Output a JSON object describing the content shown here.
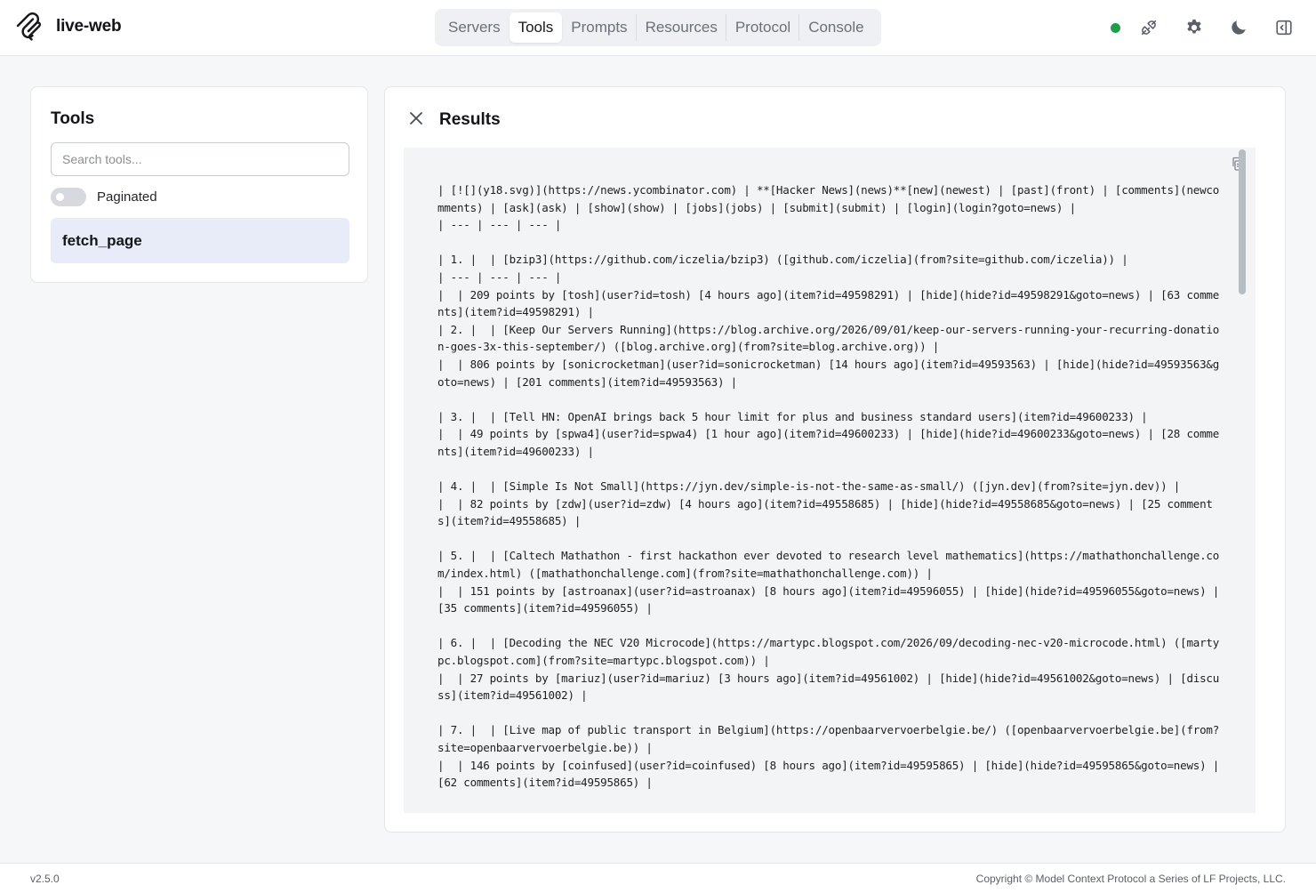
{
  "app": {
    "name": "live-web",
    "logo_icon": "mcp-logo-icon"
  },
  "nav": {
    "tabs": [
      {
        "label": "Servers",
        "active": false
      },
      {
        "label": "Tools",
        "active": true
      },
      {
        "label": "Prompts",
        "active": false
      },
      {
        "label": "Resources",
        "active": false
      },
      {
        "label": "Protocol",
        "active": false
      },
      {
        "label": "Console",
        "active": false
      }
    ]
  },
  "header": {
    "status_color": "#1f9d4c",
    "icons": [
      "connection-icon",
      "gear-icon",
      "moon-icon",
      "sidebar-toggle-icon"
    ]
  },
  "tools_panel": {
    "title": "Tools",
    "search_placeholder": "Search tools...",
    "search_value": "",
    "paginated_label": "Paginated",
    "paginated_on": false,
    "items": [
      {
        "label": "fetch_page",
        "selected": true
      }
    ]
  },
  "results_panel": {
    "title": "Results",
    "content": "| [![](y18.svg)](https://news.ycombinator.com) | **[Hacker News](news)**[new](newest) | [past](front) | [comments](newcomments) | [ask](ask) | [show](show) | [jobs](jobs) | [submit](submit) | [login](login?goto=news) |\n| --- | --- | --- |\n\n| 1. |  | [bzip3](https://github.com/iczelia/bzip3) ([github.com/iczelia](from?site=github.com/iczelia)) |\n| --- | --- | --- |\n|  | 209 points by [tosh](user?id=tosh) [4 hours ago](item?id=49598291) | [hide](hide?id=49598291&goto=news) | [63 comments](item?id=49598291) |\n| 2. |  | [Keep Our Servers Running](https://blog.archive.org/2026/09/01/keep-our-servers-running-your-recurring-donation-goes-3x-this-september/) ([blog.archive.org](from?site=blog.archive.org)) |\n|  | 806 points by [sonicrocketman](user?id=sonicrocketman) [14 hours ago](item?id=49593563) | [hide](hide?id=49593563&goto=news) | [201 comments](item?id=49593563) |\n\n| 3. |  | [Tell HN: OpenAI brings back 5 hour limit for plus and business standard users](item?id=49600233) |\n|  | 49 points by [spwa4](user?id=spwa4) [1 hour ago](item?id=49600233) | [hide](hide?id=49600233&goto=news) | [28 comments](item?id=49600233) |\n\n| 4. |  | [Simple Is Not Small](https://jyn.dev/simple-is-not-the-same-as-small/) ([jyn.dev](from?site=jyn.dev)) |\n|  | 82 points by [zdw](user?id=zdw) [4 hours ago](item?id=49558685) | [hide](hide?id=49558685&goto=news) | [25 comments](item?id=49558685) |\n\n| 5. |  | [Caltech Mathathon - first hackathon ever devoted to research level mathematics](https://mathathonchallenge.com/index.html) ([mathathonchallenge.com](from?site=mathathonchallenge.com)) |\n|  | 151 points by [astroanax](user?id=astroanax) [8 hours ago](item?id=49596055) | [hide](hide?id=49596055&goto=news) | [35 comments](item?id=49596055) |\n\n| 6. |  | [Decoding the NEC V20 Microcode](https://martypc.blogspot.com/2026/09/decoding-nec-v20-microcode.html) ([martypc.blogspot.com](from?site=martypc.blogspot.com)) |\n|  | 27 points by [mariuz](user?id=mariuz) [3 hours ago](item?id=49561002) | [hide](hide?id=49561002&goto=news) | [discuss](item?id=49561002) |\n\n| 7. |  | [Live map of public transport in Belgium](https://openbaarvervoerbelgie.be/) ([openbaarvervoerbelgie.be](from?site=openbaarvervoerbelgie.be)) |\n|  | 146 points by [coinfused](user?id=coinfused) [8 hours ago](item?id=49595865) | [hide](hide?id=49595865&goto=news) | [62 comments](item?id=49595865) |",
    "close_icon": "close-icon",
    "copy_icon": "copy-icon"
  },
  "footer": {
    "version": "v2.5.0",
    "copyright": "Copyright © Model Context Protocol a Series of LF Projects, LLC."
  }
}
